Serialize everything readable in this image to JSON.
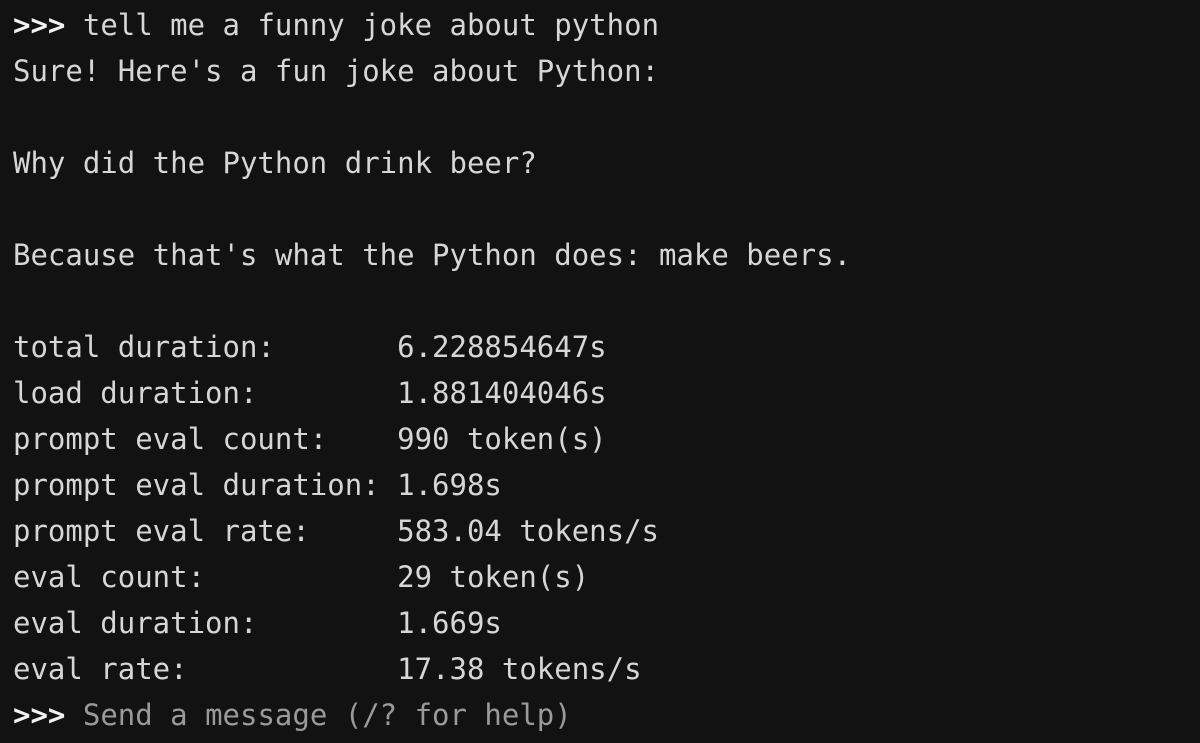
{
  "terminal": {
    "background_color": "#121212",
    "text_color": "#d6d6d6",
    "prompt_color": "#f2f2f2",
    "placeholder_color": "#9a9a9a",
    "prompt_symbol": ">>>"
  },
  "session": {
    "user_command": "tell me a funny joke about python",
    "response_lines": [
      "Sure! Here's a fun joke about Python:",
      "",
      "Why did the Python drink beer?",
      "",
      "Because that's what the Python does: make beers."
    ]
  },
  "stats": {
    "rows": [
      {
        "label": "total duration:",
        "value": "6.228854647s"
      },
      {
        "label": "load duration:",
        "value": "1.881404046s"
      },
      {
        "label": "prompt eval count:",
        "value": "990 token(s)"
      },
      {
        "label": "prompt eval duration:",
        "value": "1.698s"
      },
      {
        "label": "prompt eval rate:",
        "value": "583.04 tokens/s"
      },
      {
        "label": "eval count:",
        "value": "29 token(s)"
      },
      {
        "label": "eval duration:",
        "value": "1.669s"
      },
      {
        "label": "eval rate:",
        "value": "17.38 tokens/s"
      }
    ]
  },
  "input": {
    "prompt_symbol": ">>>",
    "placeholder": "Send a message (/? for help)",
    "value": ""
  }
}
